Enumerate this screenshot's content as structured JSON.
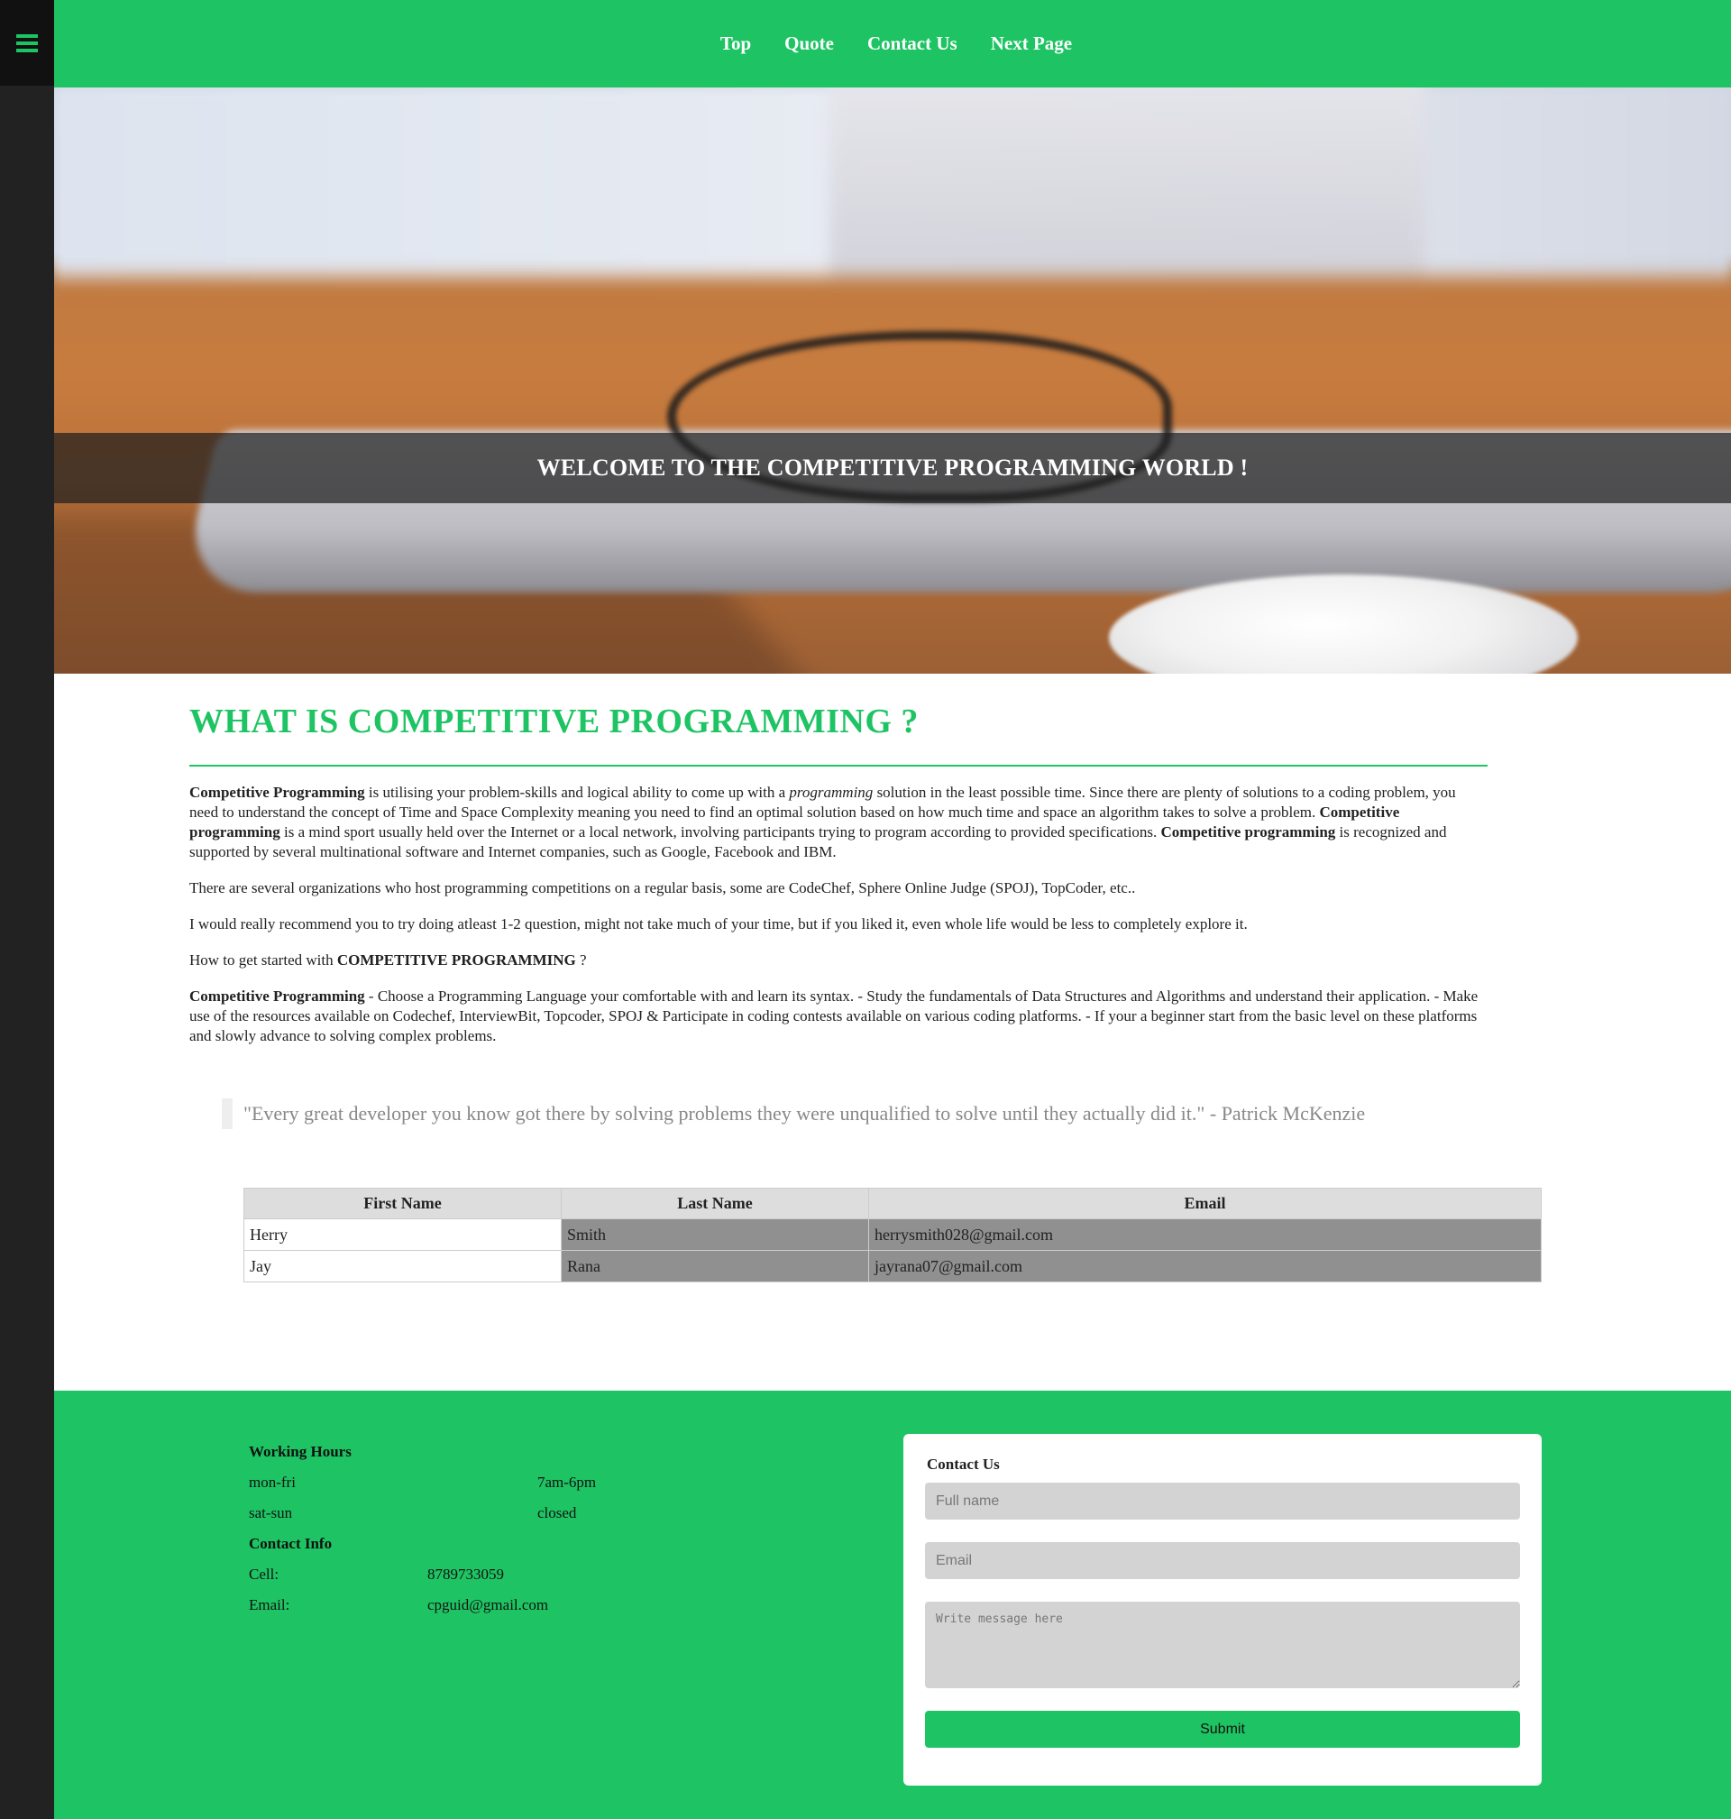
{
  "nav": {
    "items": [
      "Top",
      "Quote",
      "Contact Us",
      "Next Page"
    ]
  },
  "hero": {
    "title": "WELCOME TO THE COMPETITIVE PROGRAMMING WORLD !"
  },
  "content": {
    "heading": "WHAT IS COMPETITIVE PROGRAMMING ?",
    "p1": {
      "b1": "Competitive Programming",
      "t1": " is utilising your problem-skills and logical ability to come up with a ",
      "i1": "programming",
      "t2": " solution in the least possible time. Since there are plenty of solutions to a coding problem, you need to understand the concept of Time and Space Complexity meaning you need to find an optimal solution based on how much time and space an algorithm takes to solve a problem. ",
      "b2": "Competitive programming",
      "t3": " is a mind sport usually held over the Internet or a local network, involving participants trying to program according to provided specifications. ",
      "b3": "Competitive programming",
      "t4": " is recognized and supported by several multinational software and Internet companies, such as Google, Facebook and IBM."
    },
    "p2": "There are several organizations who host programming competitions on a regular basis, some are CodeChef, Sphere Online Judge (SPOJ), TopCoder, etc..",
    "p3": "I would really recommend you to try doing atleast 1-2 question, might not take much of your time, but if you liked it, even whole life would be less to completely explore it.",
    "p4": {
      "t1": "How to get started with ",
      "b1": "COMPETITIVE PROGRAMMING",
      "t2": " ?"
    },
    "p5": {
      "b1": "Competitive Programming",
      "t1": " - Choose a Programming Language your comfortable with and learn its syntax. - Study the fundamentals of Data Structures and Algorithms and understand their application. - Make use of the resources available on Codechef, InterviewBit, Topcoder, SPOJ & Participate in coding contests available on various coding platforms. - If your a beginner start from the basic level on these platforms and slowly advance to solving complex problems."
    }
  },
  "quote": "\"Every great developer you know got there by solving problems they were unqualified to solve until they actually did it.\" - Patrick McKenzie",
  "table": {
    "headers": [
      "First Name",
      "Last Name",
      "Email"
    ],
    "rows": [
      [
        "Herry",
        "Smith",
        "herrysmith028@gmail.com"
      ],
      [
        "Jay",
        "Rana",
        "jayrana07@gmail.com"
      ]
    ]
  },
  "footer": {
    "hours_title": "Working Hours",
    "hours": [
      {
        "day": "mon-fri",
        "time": "7am-6pm"
      },
      {
        "day": "sat-sun",
        "time": "closed"
      }
    ],
    "contact_title": "Contact Info",
    "contact": [
      {
        "label": "Cell:",
        "value": "8789733059"
      },
      {
        "label": "Email:",
        "value": "cpguid@gmail.com"
      }
    ]
  },
  "form": {
    "title": "Contact Us",
    "name_placeholder": "Full name",
    "email_placeholder": "Email",
    "message_placeholder": "Write message here",
    "submit": "Submit"
  },
  "colors": {
    "accent": "#1ec463",
    "sidebar": "#222222",
    "table_grey": "#8f908f"
  }
}
